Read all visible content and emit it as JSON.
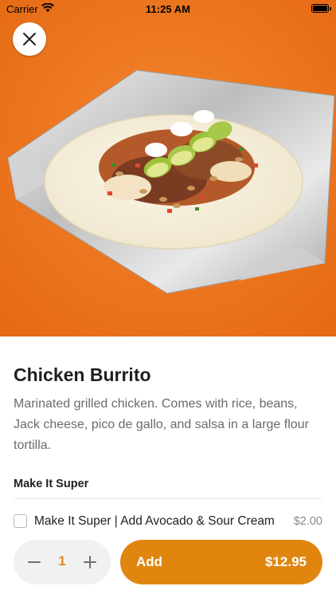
{
  "status_bar": {
    "carrier": "Carrier",
    "time": "11:25 AM"
  },
  "hero": {
    "image_subject": "chicken burrito on foil",
    "background_color": "#ee7a21"
  },
  "item": {
    "title": "Chicken Burrito",
    "description": "Marinated grilled chicken. Comes with rice, beans, Jack cheese, pico de gallo, and salsa in a large flour tortilla."
  },
  "options_section": {
    "title": "Make It Super",
    "options": [
      {
        "label": "Make It Super | Add Avocado & Sour Cream",
        "price": "$2.00",
        "checked": false
      }
    ]
  },
  "footer": {
    "quantity": "1",
    "add_label": "Add",
    "total": "$12.95",
    "accent_color": "#e0860f"
  },
  "icons": {
    "close": "close-icon",
    "minus": "minus-icon",
    "plus": "plus-icon",
    "wifi": "wifi-icon",
    "battery": "battery-icon"
  }
}
